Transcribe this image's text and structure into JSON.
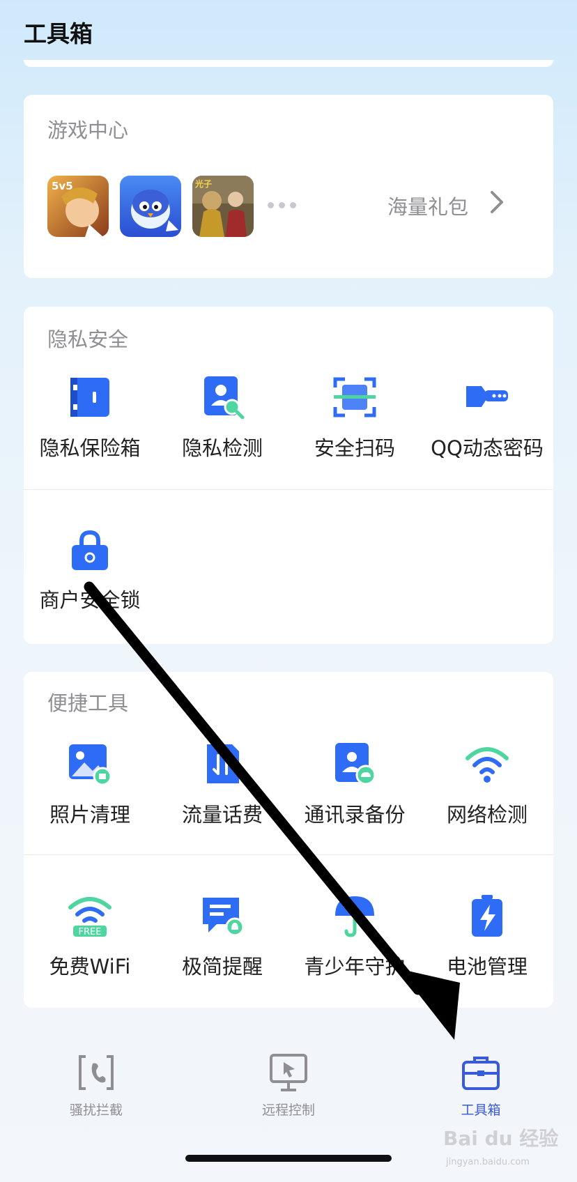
{
  "header": {
    "title": "工具箱"
  },
  "game_center": {
    "title": "游戏中心",
    "games": [
      {
        "icon": "honor-of-kings-icon",
        "badge": "5v5"
      },
      {
        "icon": "penguin-game-icon"
      },
      {
        "icon": "pubg-game-icon",
        "badge": "光子"
      }
    ],
    "gift_label": "海量礼包"
  },
  "privacy": {
    "title": "隐私安全",
    "items": [
      {
        "label": "隐私保险箱",
        "icon": "safe-box-icon"
      },
      {
        "label": "隐私检测",
        "icon": "privacy-check-icon"
      },
      {
        "label": "安全扫码",
        "icon": "scan-icon"
      },
      {
        "label": "QQ动态密码",
        "icon": "key-icon"
      },
      {
        "label": "商户安全锁",
        "icon": "lock-icon"
      }
    ]
  },
  "tools": {
    "title": "便捷工具",
    "items": [
      {
        "label": "照片清理",
        "icon": "photo-clean-icon"
      },
      {
        "label": "流量话费",
        "icon": "data-bill-icon"
      },
      {
        "label": "通讯录备份",
        "icon": "contacts-backup-icon"
      },
      {
        "label": "网络检测",
        "icon": "wifi-icon"
      },
      {
        "label": "免费WiFi",
        "icon": "free-wifi-icon",
        "badge": "FREE"
      },
      {
        "label": "极简提醒",
        "icon": "reminder-icon"
      },
      {
        "label": "青少年守护",
        "icon": "umbrella-icon"
      },
      {
        "label": "电池管理",
        "icon": "battery-icon"
      }
    ]
  },
  "tabbar": {
    "items": [
      {
        "label": "骚扰拦截",
        "icon": "call-block-icon",
        "active": false
      },
      {
        "label": "远程控制",
        "icon": "remote-control-icon",
        "active": false
      },
      {
        "label": "工具箱",
        "icon": "toolbox-icon",
        "active": true
      }
    ]
  },
  "watermark": {
    "text": "Bai du 经验",
    "sub": "jingyan.baidu.com"
  },
  "colors": {
    "accent": "#3a5bd9",
    "icon_blue": "#2f6cf6",
    "icon_green": "#4fd6a0",
    "muted": "#8e8e93"
  }
}
